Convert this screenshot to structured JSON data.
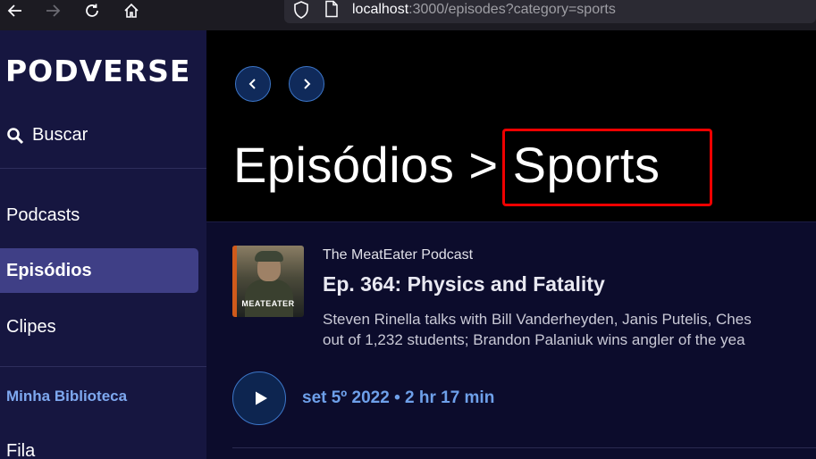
{
  "browser": {
    "url_host": "localhost",
    "url_rest": ":3000/episodes?category=sports"
  },
  "sidebar": {
    "logo": "PODVERSE",
    "search_label": "Buscar",
    "items": [
      {
        "label": "Podcasts",
        "active": false
      },
      {
        "label": "Episódios",
        "active": true
      },
      {
        "label": "Clipes",
        "active": false
      }
    ],
    "library_heading": "Minha Biblioteca",
    "library_items": [
      {
        "label": "Fila"
      }
    ]
  },
  "main": {
    "title_prefix": "Episódios > ",
    "title_category": "Sports",
    "episode": {
      "thumb_brand": "MEATEATER",
      "podcast_name": "The MeatEater Podcast",
      "title": "Ep. 364: Physics and Fatality",
      "description_line1": "Steven Rinella talks with Bill Vanderheyden, Janis Putelis, Ches",
      "description_line2": "out of 1,232 students; Brandon Palaniuk wins angler of the yea",
      "meta": "set 5º 2022 • 2 hr 17 min"
    }
  },
  "colors": {
    "sidebar_bg": "#161640",
    "active_item_bg": "#3f3f86",
    "accent_blue": "#6ea0ea",
    "highlight_red": "#ee0000"
  }
}
